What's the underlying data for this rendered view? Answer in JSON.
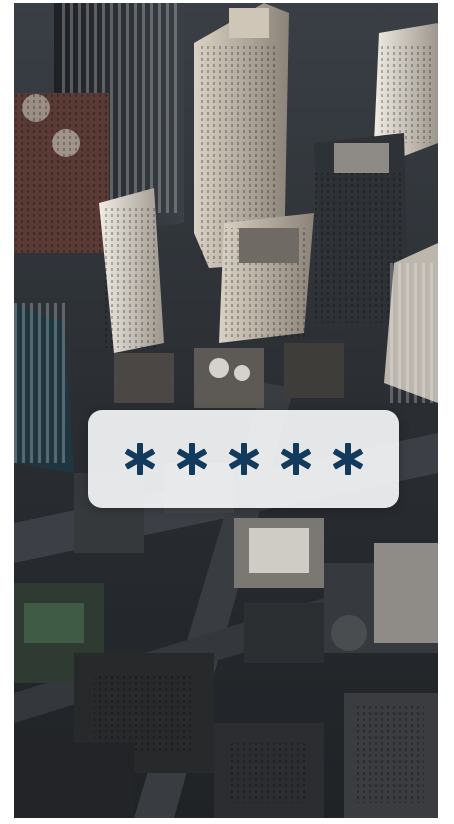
{
  "background": {
    "scene": "aerial-city-skyline-photo"
  },
  "passcode": {
    "masked_length": 5,
    "mask_glyph": "asterisk-icon",
    "mask_color": "#123a5c",
    "card_color": "#f7f8fa"
  }
}
